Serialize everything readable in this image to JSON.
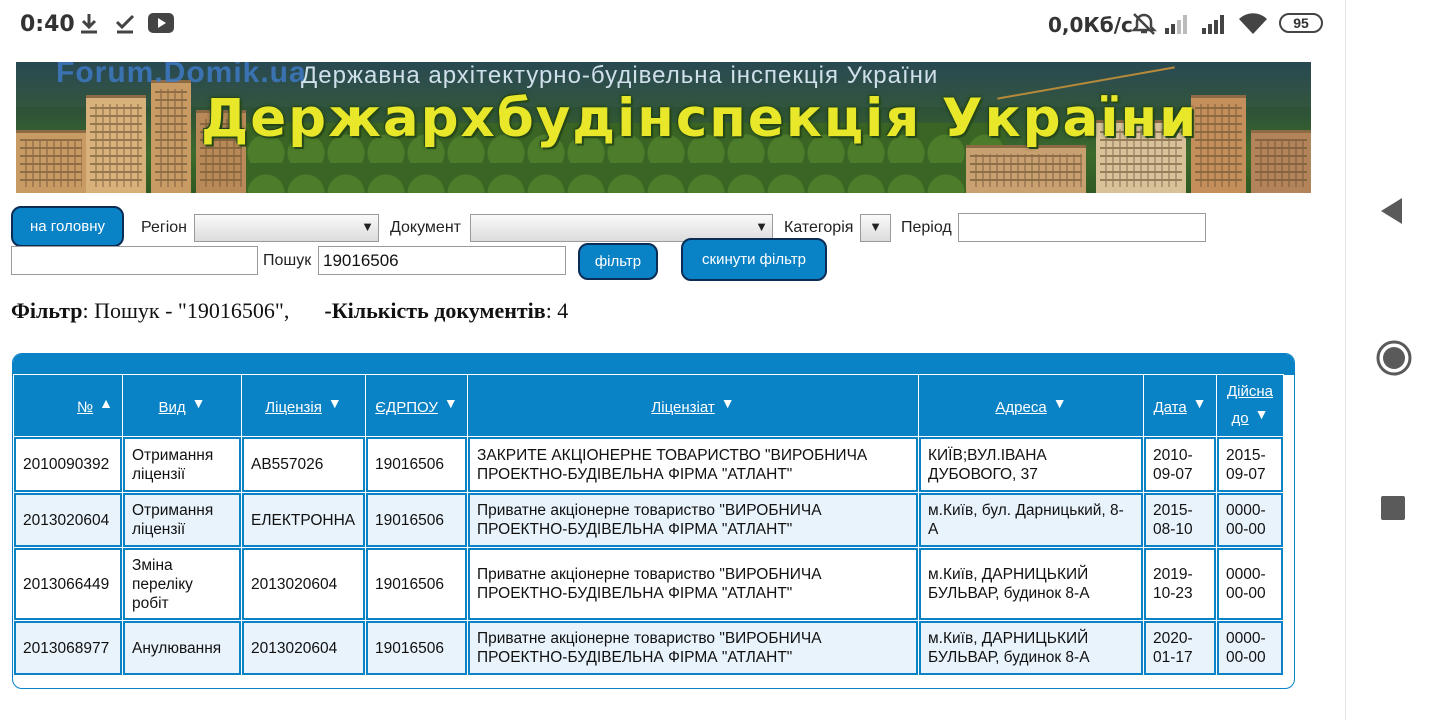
{
  "status_bar": {
    "time": "0:40",
    "icons": [
      "download-icon",
      "checkbox-icon",
      "youtube-icon"
    ],
    "network_speed": "0,0Кб/с",
    "right_icons": [
      "alarm-off-icon",
      "signal-icon",
      "signal-icon",
      "wifi-icon"
    ],
    "battery": "95"
  },
  "banner": {
    "watermark": "Forum.Domik.ua",
    "subtitle": "Державна архітектурно-будівельна інспекція України",
    "title": "Держархбудінспекція України"
  },
  "toolbar": {
    "home_button": "на головну",
    "region_label": "Регіон",
    "region_value": "",
    "document_label": "Документ",
    "document_value": "",
    "category_label": "Категорія",
    "category_value": "",
    "period_label": "Період",
    "period_from": "",
    "period_to": "",
    "search_label": "Пошук",
    "search_value": "19016506",
    "filter_button": "фільтр",
    "reset_button": "скинути фільтр"
  },
  "filter_summary": {
    "filter_label": "Фільтр",
    "filter_text": ": Пошук - \"19016506\",",
    "count_label": "-Кількість документів",
    "count_text": ": 4"
  },
  "table": {
    "headers": [
      {
        "label": "№",
        "sort": "▲"
      },
      {
        "label": "Вид",
        "sort": "▼"
      },
      {
        "label": "Ліцензія",
        "sort": "▼"
      },
      {
        "label": "ЄДРПОУ",
        "sort": "▼"
      },
      {
        "label": "Ліцензіат",
        "sort": "▼"
      },
      {
        "label": "Адреса",
        "sort": "▼"
      },
      {
        "label": "Дата",
        "sort": "▼"
      },
      {
        "label": "Дійсна до",
        "sort": "▼"
      }
    ],
    "rows": [
      [
        "2010090392",
        "Отримання ліцензії",
        "АВ557026",
        "19016506",
        "ЗАКРИТЕ АКЦІОНЕРНЕ ТОВАРИСТВО \"ВИРОБНИЧА ПРОЕКТНО-БУДІВЕЛЬНА ФІРМА \"АТЛАНТ\"",
        "КИЇВ;ВУЛ.ІВАНА ДУБОВОГО, 37",
        "2010-09-07",
        "2015-09-07"
      ],
      [
        "2013020604",
        "Отримання ліцензії",
        "ЕЛЕКТРОННА",
        "19016506",
        "Приватне акціонерне товариство \"ВИРОБНИЧА ПРОЕКТНО-БУДІВЕЛЬНА ФІРМА \"АТЛАНТ\"",
        "м.Київ, бул. Дарницький, 8-А",
        "2015-08-10",
        "0000-00-00"
      ],
      [
        "2013066449",
        "Зміна переліку робіт",
        "2013020604",
        "19016506",
        "Приватне акціонерне товариство \"ВИРОБНИЧА ПРОЕКТНО-БУДІВЕЛЬНА ФІРМА \"АТЛАНТ\"",
        "м.Київ,  ДАРНИЦЬКИЙ БУЛЬВАР, будинок 8-А",
        "2019-10-23",
        "0000-00-00"
      ],
      [
        "2013068977",
        "Анулювання",
        "2013020604",
        "19016506",
        "Приватне акціонерне товариство \"ВИРОБНИЧА ПРОЕКТНО-БУДІВЕЛЬНА ФІРМА \"АТЛАНТ\"",
        "м.Київ,  ДАРНИЦЬКИЙ БУЛЬВАР, будинок 8-А",
        "2020-01-17",
        "0000-00-00"
      ]
    ]
  },
  "nav": [
    "back-icon",
    "home-icon",
    "recents-icon"
  ],
  "colors": {
    "accent": "#0a82c6",
    "row_alt": "#e9f3fc",
    "banner_title": "#e8e72a"
  }
}
